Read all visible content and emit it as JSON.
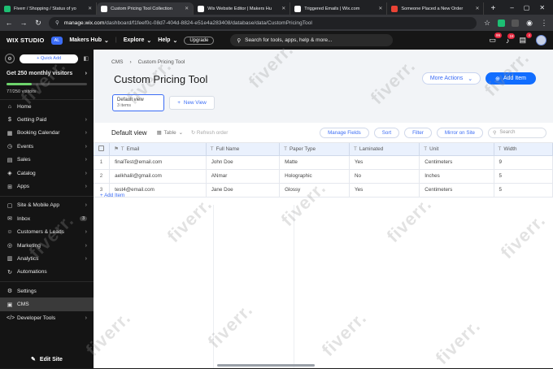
{
  "browser": {
    "tabs": [
      {
        "title": "Fiverr / Shopping / Status of yo",
        "color": "#1dbf73",
        "active": false
      },
      {
        "title": "Custom Pricing Tool Collection",
        "color": "#ffffff",
        "active": true
      },
      {
        "title": "Wix Website Editor | Makers Hu",
        "color": "#ffffff",
        "active": false
      },
      {
        "title": "Triggered Emails | Wix.com",
        "color": "#ffffff",
        "active": false
      },
      {
        "title": "Someone Placed a New Order",
        "color": "#ea4335",
        "active": false
      }
    ],
    "url_host": "manage.wix.com",
    "url_path": "/dashboard/f1feef0c-08d7-404d-8824-e51e4a283408/database/data/CustomPricingTool"
  },
  "wix": {
    "logo": "WIX STUDIO",
    "workspace": "AL",
    "site": "Makers Hub",
    "explore": "Explore",
    "help": "Help",
    "upgrade": "Upgrade",
    "search_placeholder": "Search for tools, apps, help & more...",
    "badges": {
      "messages": "99",
      "notifications": "18",
      "updates": "4"
    }
  },
  "sidebar": {
    "quick_add": "+ Quick Add",
    "promo_title": "Get 250 monthly visitors",
    "promo_count": "77/250 visitors",
    "promo_progress": 0.31,
    "items": [
      {
        "label": "Home",
        "icon": "⌂",
        "chev": false
      },
      {
        "label": "Getting Paid",
        "icon": "$",
        "chev": true
      },
      {
        "label": "Booking Calendar",
        "icon": "▦",
        "chev": true
      },
      {
        "label": "Events",
        "icon": "◷",
        "chev": true
      },
      {
        "label": "Sales",
        "icon": "▤",
        "chev": true
      },
      {
        "label": "Catalog",
        "icon": "◈",
        "chev": true
      },
      {
        "label": "Apps",
        "icon": "⊞",
        "chev": true
      },
      {
        "label": "Site & Mobile App",
        "icon": "▢",
        "chev": true
      },
      {
        "label": "Inbox",
        "icon": "✉",
        "chev": false,
        "count": "3"
      },
      {
        "label": "Customers & Leads",
        "icon": "☺",
        "chev": true
      },
      {
        "label": "Marketing",
        "icon": "◎",
        "chev": true
      },
      {
        "label": "Analytics",
        "icon": "▥",
        "chev": true
      },
      {
        "label": "Automations",
        "icon": "↻",
        "chev": false
      },
      {
        "label": "Settings",
        "icon": "⚙",
        "chev": false
      },
      {
        "label": "CMS",
        "icon": "▣",
        "chev": false,
        "selected": true
      },
      {
        "label": "Developer Tools",
        "icon": "</>",
        "chev": true
      }
    ],
    "edit_site": "Edit Site"
  },
  "main": {
    "breadcrumb": [
      "CMS",
      "Custom Pricing Tool"
    ],
    "title": "Custom Pricing Tool",
    "more_actions": "More Actions",
    "add_item": "Add Item",
    "view_name": "Default view",
    "view_count": "3 items",
    "new_view": "New View",
    "toolbar": {
      "view_label": "Default view",
      "layout": "Table",
      "refresh": "Refresh order",
      "manage": "Manage Fields",
      "sort": "Sort",
      "filter": "Filter",
      "mirror": "Mirror on Site",
      "search": "Search"
    },
    "columns": [
      "Email",
      "Full Name",
      "Paper Type",
      "Laminated",
      "Unit",
      "Width"
    ],
    "rows": [
      [
        "1",
        "finalTest@email.com",
        "John Doe",
        "Matte",
        "Yes",
        "Centimeters",
        "9"
      ],
      [
        "2",
        "aelkhalil@gmail.com",
        "ANmar",
        "Holographic",
        "No",
        "Inches",
        "5"
      ],
      [
        "3",
        "test4@email.com",
        "Jane Doe",
        "Glossy",
        "Yes",
        "Centimeters",
        "5"
      ]
    ],
    "add_row": "+ Add Item"
  },
  "watermark": "fiverr."
}
